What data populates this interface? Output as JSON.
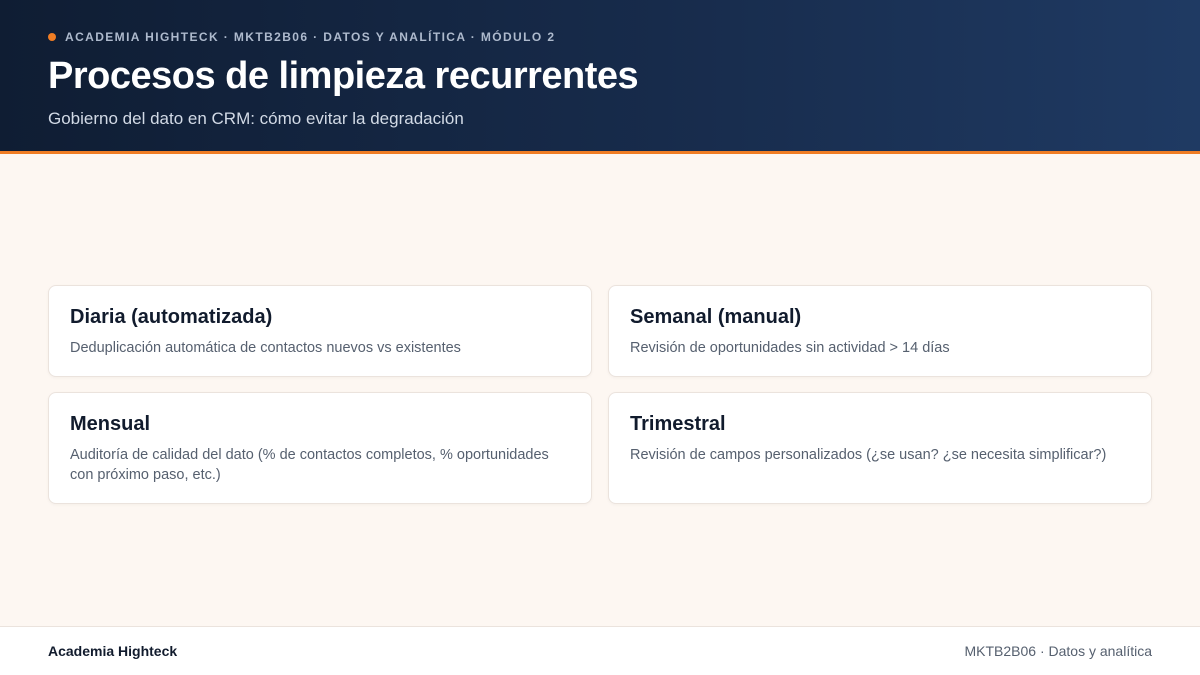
{
  "header": {
    "eyebrow": "Academia Highteck · MKTB2B06 · Datos y analítica · Módulo 2",
    "title": "Procesos de limpieza recurrentes",
    "subtitle": "Gobierno del dato en CRM: cómo evitar la degradación"
  },
  "cards": [
    {
      "title": "Diaria (automatizada)",
      "description": "Deduplicación automática de contactos nuevos vs existentes"
    },
    {
      "title": "Semanal (manual)",
      "description": "Revisión de oportunidades sin actividad > 14 días"
    },
    {
      "title": "Mensual",
      "description": "Auditoría de calidad del dato (% de contactos completos, % oportunidades con próximo paso, etc.)"
    },
    {
      "title": "Trimestral",
      "description": "Revisión de campos personalizados (¿se usan? ¿se necesita simplificar?)"
    }
  ],
  "footer": {
    "brand": "Academia Highteck",
    "course": "MKTB2B06 · Datos y analítica"
  },
  "colors": {
    "accent": "#f07d24",
    "header_bg": "#172b4b",
    "page_bg": "#fdf7f2"
  }
}
